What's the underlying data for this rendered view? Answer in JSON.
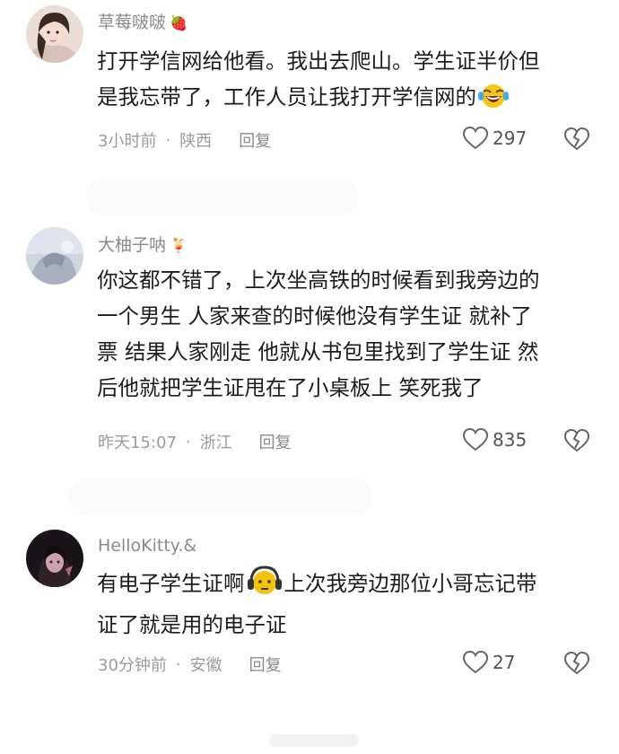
{
  "comments": [
    {
      "username": "草莓啵啵",
      "username_emoji": "🍓",
      "lines": [
        "打开学信网给他看。我出去爬山。学生证半价但",
        "是我忘带了，工作人员让我打开学信网的"
      ],
      "end_emoji": "laughing-crying-face",
      "time": "3小时前",
      "location": "陕西",
      "reply_label": "回复",
      "likes": "297"
    },
    {
      "username": "大柚子呐",
      "username_emoji": "🍹",
      "lines": [
        "你这都不错了，上次坐高铁的时候看到我旁边的",
        "一个男生 人家来查的时候他没有学生证 就补了",
        "票 结果人家刚走 他就从书包里找到了学生证 然",
        "后他就把学生证甩在了小桌板上 笑死我了"
      ],
      "time": "昨天15:07",
      "location": "浙江",
      "reply_label": "回复",
      "likes": "835"
    },
    {
      "username": "HelloKitty.&",
      "line1_part1": "有电子学生证啊",
      "inline_emoji": "headphone-face",
      "line1_part2": "上次我旁边那位小哥忘记带",
      "line2": "证了就是用的电子证",
      "time": "30分钟前",
      "location": "安徽",
      "reply_label": "回复",
      "likes": "27"
    }
  ],
  "separator": "·",
  "icons": {
    "like": "heart-outline-icon",
    "dislike": "broken-heart-icon"
  },
  "colors": {
    "text": "#1c1c1c",
    "username": "#8a8a8a",
    "meta": "#9b9b9b"
  }
}
